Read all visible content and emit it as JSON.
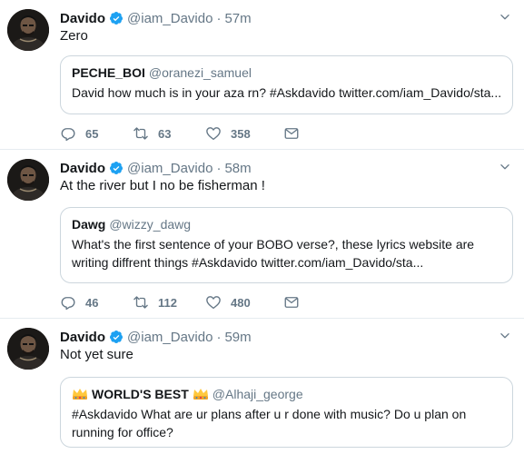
{
  "tweets": [
    {
      "name": "Davido",
      "handle": "@iam_Davido",
      "dot": "·",
      "time": "57m",
      "text": "Zero",
      "quote": {
        "name": "PECHE_BOI",
        "handle": "@oranezi_samuel",
        "text": "David how much is in your aza rn? #Askdavido twitter.com/iam_Davido/sta..."
      },
      "replies": "65",
      "retweets": "63",
      "likes": "358"
    },
    {
      "name": "Davido",
      "handle": "@iam_Davido",
      "dot": "·",
      "time": "58m",
      "text": "At the river but I no be fisherman !",
      "quote": {
        "name": "Dawg",
        "handle": "@wizzy_dawg",
        "text": "What's the first sentence of your BOBO verse?, these lyrics website are writing diffrent things #Askdavido twitter.com/iam_Davido/sta..."
      },
      "replies": "46",
      "retweets": "112",
      "likes": "480"
    },
    {
      "name": "Davido",
      "handle": "@iam_Davido",
      "dot": "·",
      "time": "59m",
      "text": "Not yet sure",
      "quote": {
        "name": "WORLD'S BEST",
        "handle": "@Alhaji_george",
        "text": "#Askdavido What are ur plans after u r done with music? Do u plan on running for office?"
      }
    }
  ],
  "colors": {
    "verified": "#1da1f2",
    "muted": "#657786",
    "border": "#e6ecf0",
    "quote_border": "#ccd6dd"
  },
  "icons": [
    "reply-icon",
    "retweet-icon",
    "like-icon",
    "message-icon",
    "verified-icon",
    "chevron-down-icon",
    "crown-icon"
  ]
}
